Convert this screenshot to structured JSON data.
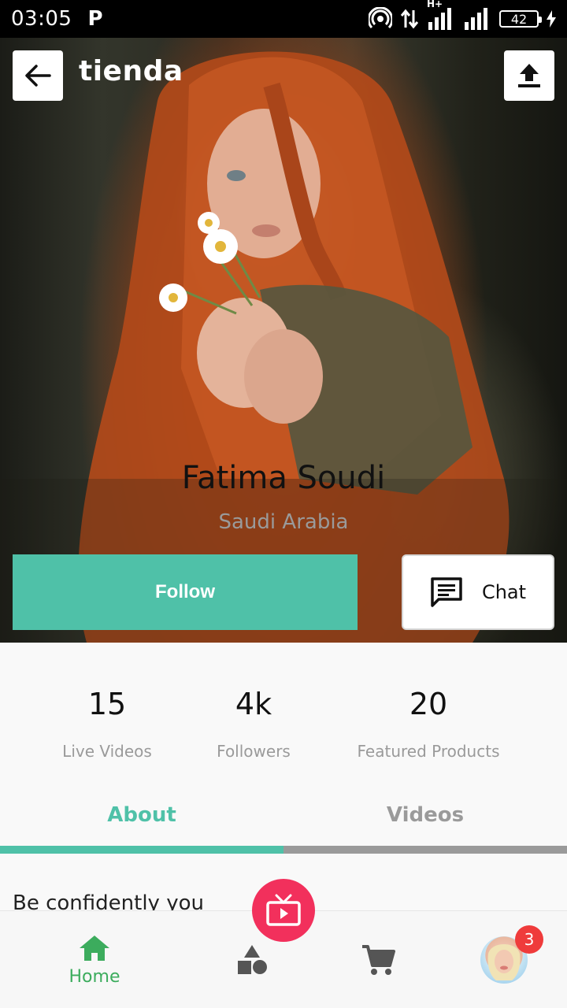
{
  "status_bar": {
    "time": "03:05",
    "notification_icon": "P",
    "network_type": "H+",
    "battery_level": "42"
  },
  "header": {
    "brand": "tienda",
    "back_icon": "arrow-left-icon",
    "share_icon": "upload-icon"
  },
  "profile": {
    "name": "Fatima Soudi",
    "country": "Saudi Arabia",
    "follow_label": "Follow",
    "chat_label": "Chat"
  },
  "stats": [
    {
      "value": "15",
      "label": "Live Videos"
    },
    {
      "value": "4k",
      "label": "Followers"
    },
    {
      "value": "20",
      "label": "Featured Products"
    }
  ],
  "tabs": [
    {
      "label": "About",
      "active": true
    },
    {
      "label": "Videos",
      "active": false
    }
  ],
  "about": {
    "text": "Be confidently you"
  },
  "bottom_nav": {
    "home_label": "Home",
    "cart_badge": "3"
  },
  "colors": {
    "accent": "#4fc1a8",
    "home_green": "#3cac5d",
    "live_pink": "#f2305c",
    "badge_red": "#ef3b3b",
    "inactive_gray": "#9a9a9a"
  }
}
